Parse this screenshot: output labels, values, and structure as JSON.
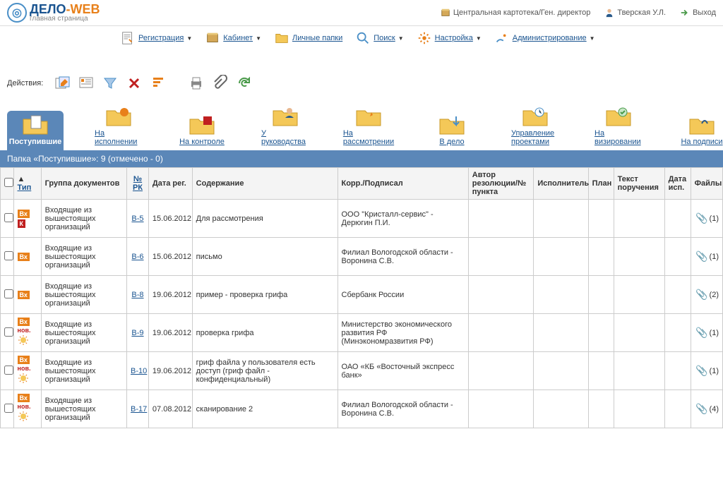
{
  "header": {
    "logo_title_1": "ДЕЛО",
    "logo_title_2": "-WEB",
    "logo_sub": "главная страница",
    "org": "Центральная картотека/Ген. директор",
    "user": "Тверская У.Л.",
    "exit": "Выход"
  },
  "nav": {
    "registration": "Регистрация",
    "cabinet": "Кабинет",
    "personal_folders": "Личные папки",
    "search": "Поиск",
    "settings": "Настройка",
    "admin": "Администрирование"
  },
  "actions_label": "Действия:",
  "tabs": {
    "incoming": "Поступившие",
    "execution": "На исполнении",
    "control": "На контроле",
    "management": "У руководства",
    "consideration": "На рассмотрении",
    "to_case": "В дело",
    "projects": "Управление проектами",
    "visa": "На визировании",
    "signing": "На подписи"
  },
  "folder_title": "Папка «Поступившие»: 9 (отмечено - 0)",
  "columns": {
    "type": "Тип",
    "group": "Группа документов",
    "rk": "№ РК",
    "date": "Дата рег.",
    "content": "Содержание",
    "corr": "Корр./Подписал",
    "author": "Автор резолюции/№ пункта",
    "executor": "Исполнитель",
    "plan": "План",
    "order_text": "Текст поручения",
    "date_exec": "Дата исп.",
    "file": "Файлы"
  },
  "rows": [
    {
      "badges": [
        "Вх",
        "К"
      ],
      "new": false,
      "group": "Входящие из вышестоящих организаций",
      "rk": "В-5",
      "date": "15.06.2012",
      "content": "Для рассмотрения",
      "corr": "ООО \"Кристалл-сервис\" - Дерюгин П.И.",
      "files": "(1)"
    },
    {
      "badges": [
        "Вх"
      ],
      "new": false,
      "group": "Входящие из вышестоящих организаций",
      "rk": "В-6",
      "date": "15.06.2012",
      "content": "письмо",
      "corr": "Филиал Вологодской области - Воронина С.В.",
      "files": "(1)"
    },
    {
      "badges": [
        "Вх"
      ],
      "new": false,
      "group": "Входящие из вышестоящих организаций",
      "rk": "В-8",
      "date": "19.06.2012",
      "content": "пример - проверка грифа",
      "corr": "Сбербанк России",
      "files": "(2)"
    },
    {
      "badges": [
        "Вх"
      ],
      "new": true,
      "group": "Входящие из вышестоящих организаций",
      "rk": "В-9",
      "date": "19.06.2012",
      "content": "проверка грифа",
      "corr": "Министерство экономического развития РФ (Минэкономразвития РФ)",
      "files": "(1)"
    },
    {
      "badges": [
        "Вх"
      ],
      "new": true,
      "group": "Входящие из вышестоящих организаций",
      "rk": "В-10",
      "date": "19.06.2012",
      "content": "гриф файла у пользователя есть доступ (гриф файл - конфиденциальный)",
      "corr": "ОАО «КБ «Восточный экспресс банк»",
      "files": "(1)"
    },
    {
      "badges": [
        "Вх"
      ],
      "new": true,
      "group": "Входящие из вышестоящих организаций",
      "rk": "В-17",
      "date": "07.08.2012",
      "content": "сканирование 2",
      "corr": "Филиал Вологодской области - Воронина С.В.",
      "files": "(4)"
    }
  ],
  "nov_label": "нов."
}
